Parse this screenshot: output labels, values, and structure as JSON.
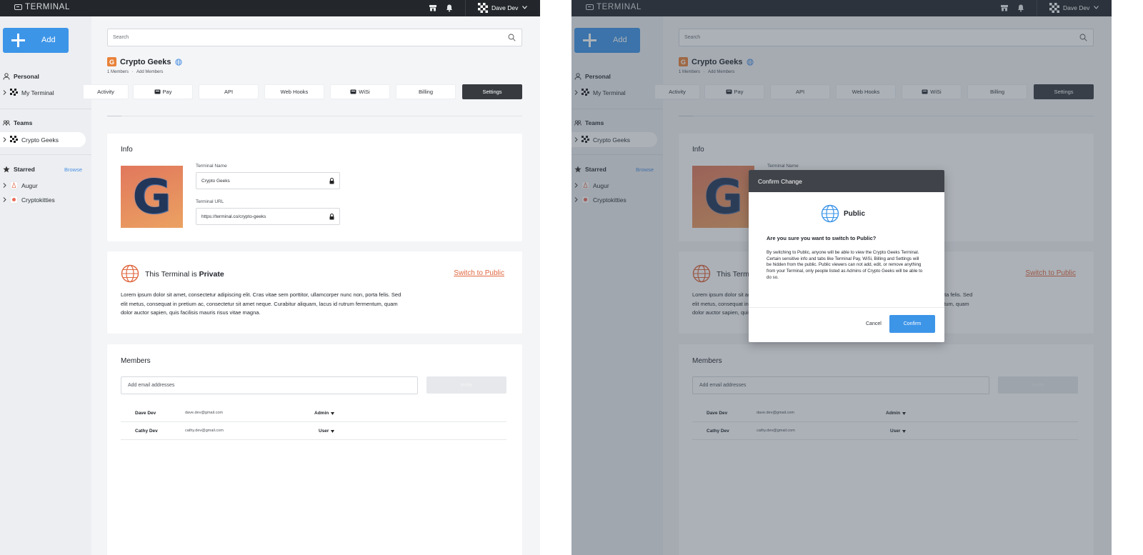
{
  "app": {
    "logo_text": "TERMINAL",
    "user_name": "Dave Dev"
  },
  "sidebar": {
    "add_label": "Add",
    "personal_label": "Personal",
    "my_terminal_label": "My Terminal",
    "teams_label": "Teams",
    "crypto_geeks_label": "Crypto Geeks",
    "starred_label": "Starred",
    "browse_label": "Browse",
    "starred_items": [
      "Augur",
      "Cryptokitties"
    ]
  },
  "search": {
    "placeholder": "Search"
  },
  "team": {
    "badge": "G",
    "name": "Crypto Geeks",
    "members_count": "1 Members",
    "add_members": "Add Members",
    "separator": "·"
  },
  "tabs": [
    "Activity",
    "Pay",
    "API",
    "Web Hooks",
    "WiSi",
    "Billing",
    "Settings"
  ],
  "active_tab": "Settings",
  "info": {
    "title": "Info",
    "logo_letter": "G",
    "name_label": "Terminal Name",
    "name_value": "Crypto Geeks",
    "url_label": "Terminal URL",
    "url_value": "https://terminal.co/crypto-geeks"
  },
  "privacy": {
    "prefix": "This Terminal is ",
    "state": "Private",
    "switch_label": "Switch to Public",
    "description": "Lorem ipsum dolor sit amet, consectetur adipiscing elit. Cras vitae sem porttitor, ullamcorper nunc non, porta felis. Sed elit metus, consequat in pretium ac, consectetur sit amet neque. Curabitur aliquam, lacus id rutrum fermentum, quam dolor auctor sapien, quis facilisis mauris risus vitae magna."
  },
  "members": {
    "title": "Members",
    "email_placeholder": "Add email addresses",
    "invite_label": "Invite",
    "rows": [
      {
        "name": "Dave Dev",
        "email": "dave.dev@gmail.com",
        "role": "Admin"
      },
      {
        "name": "Cathy Dev",
        "email": "cathy.dev@gmail.com",
        "role": "User"
      }
    ]
  },
  "modal": {
    "title": "Confirm Change",
    "heading": "Public",
    "question": "Are you sure you want to switch to Public?",
    "body": "By switching to Public, anyone will be able to view the Crypto Geeks Terminal. Certain sensitive info and tabs like Terminal Pay, WiSi, Billing and Settings will be hidden from the public. Public viewers can not add, edit, or remove anything from your Terminal, only people listed as Admins of Crypto Geeks will be able to do so.",
    "cancel_label": "Cancel",
    "confirm_label": "Confirm"
  },
  "colors": {
    "accent": "#3d95e8",
    "topbar": "#23272b",
    "link_orange": "#e0673f",
    "active_tab": "#373b40"
  }
}
